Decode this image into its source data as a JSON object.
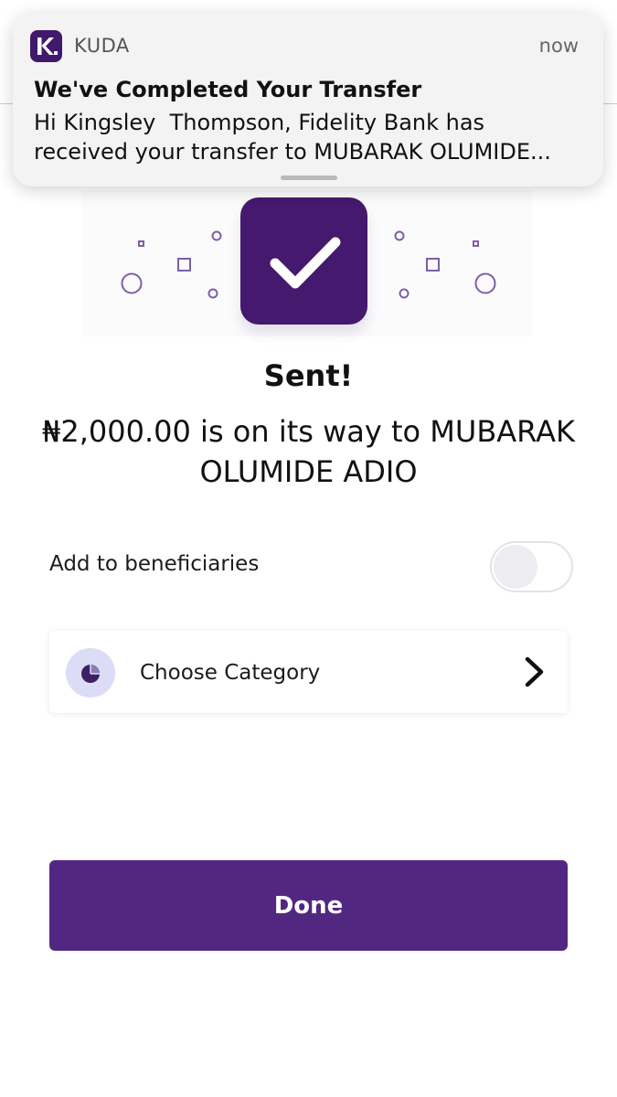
{
  "notification": {
    "app_name": "KUDA",
    "time": "now",
    "title": "We've Completed Your Transfer",
    "body": "Hi Kingsley  Thompson, Fidelity Bank has received your transfer to MUBARAK OLUMIDE..."
  },
  "success": {
    "title": "Sent!",
    "message": "₦2,000.00 is on its way to MUBARAK OLUMIDE ADIO"
  },
  "beneficiaries": {
    "label": "Add to beneficiaries",
    "toggle_on": false
  },
  "category": {
    "label": "Choose Category",
    "icon": "pie-chart-icon"
  },
  "done_button": {
    "label": "Done"
  },
  "colors": {
    "brand_purple": "#44196e",
    "button_purple": "#522781",
    "icon_bg": "#dcdcf7",
    "decor_purple": "#7d5fa8"
  }
}
